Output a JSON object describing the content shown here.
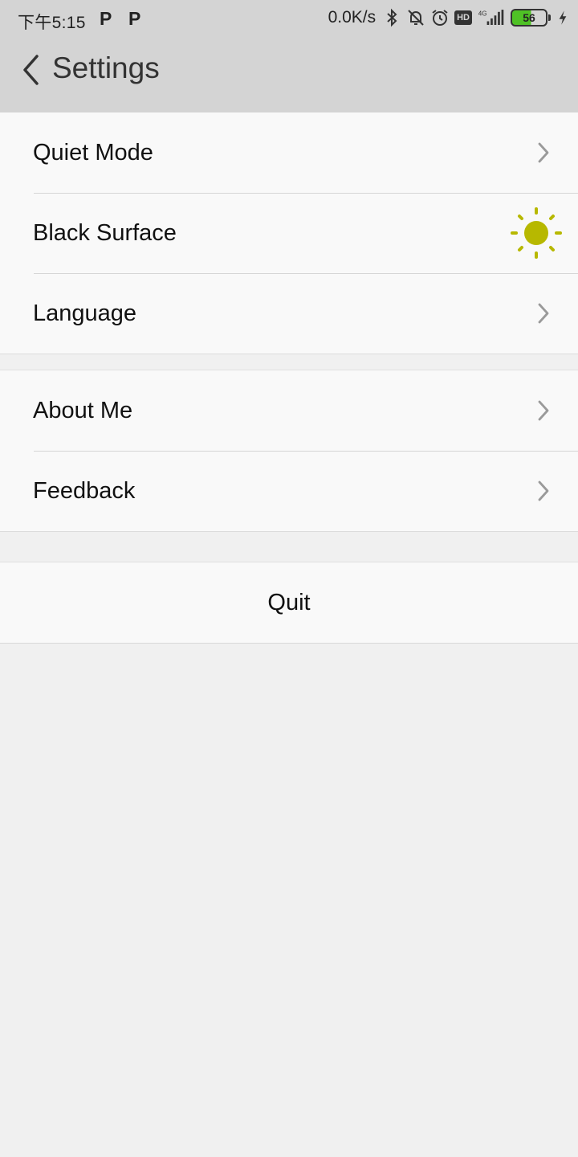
{
  "status_bar": {
    "time": "下午5:15",
    "notif_1": "P",
    "notif_2": "P",
    "network_speed": "0.0K/s",
    "hd": "HD",
    "signal_type": "4G",
    "battery": "56",
    "icons": [
      "bluetooth-icon",
      "bell-off-icon",
      "alarm-icon",
      "hd-icon",
      "signal-4g-icon",
      "battery-icon",
      "charging-icon"
    ]
  },
  "header": {
    "title": "Settings",
    "back_icon": "chevron-left-icon"
  },
  "groups": [
    {
      "items": [
        {
          "label": "Quiet Mode",
          "trailing": "chevron-right-icon"
        },
        {
          "label": "Black Surface",
          "trailing": "sun-icon"
        },
        {
          "label": "Language",
          "trailing": "chevron-right-icon"
        }
      ]
    },
    {
      "items": [
        {
          "label": "About Me",
          "trailing": "chevron-right-icon"
        },
        {
          "label": "Feedback",
          "trailing": "chevron-right-icon"
        }
      ]
    }
  ],
  "quit_label": "Quit",
  "colors": {
    "header_bg": "#d4d4d4",
    "page_bg": "#f0f0f0",
    "row_bg": "#f9f9f9",
    "sun": "#b7b800",
    "chevron": "#9a9a9a",
    "battery": "#4fc125"
  }
}
